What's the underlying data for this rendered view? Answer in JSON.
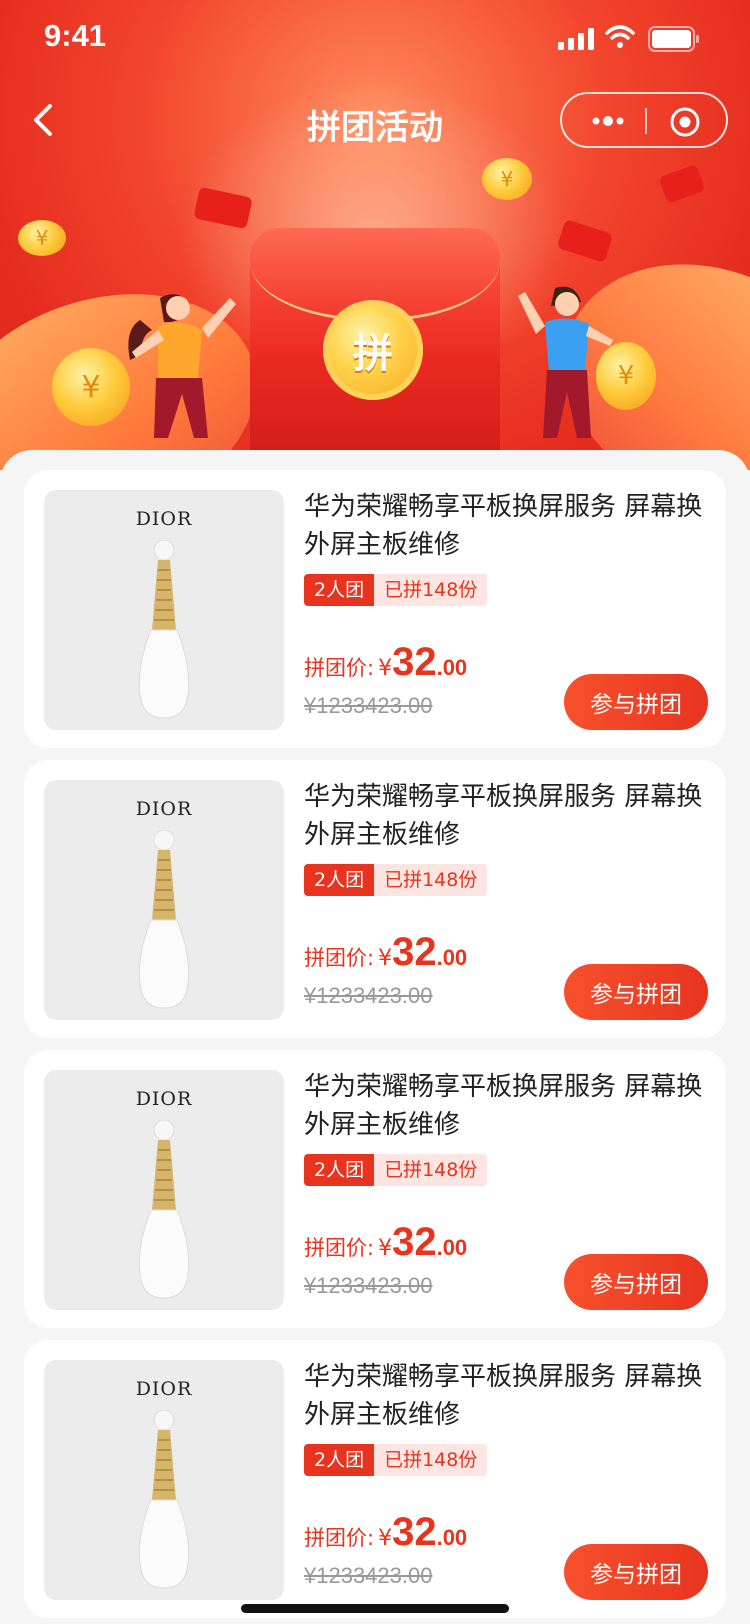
{
  "status_bar": {
    "time": "9:41"
  },
  "nav": {
    "title": "拼团活动",
    "back_icon": "chevron-left-icon",
    "more_icon": "more-dots-icon",
    "close_icon": "target-circle-icon"
  },
  "banner": {
    "badge_text": "拼",
    "coin_symbol": "¥"
  },
  "products": [
    {
      "brand": "DIOR",
      "name": "华为荣耀畅享平板换屏服务 屏幕换外屏主板维修",
      "group_tag": "2人团",
      "joined_tag": "已拼148份",
      "price_label": "拼团价:",
      "currency": "¥",
      "price_int": "32",
      "price_dec": ".00",
      "original_price": "¥1233423.00",
      "button": "参与拼团"
    },
    {
      "brand": "DIOR",
      "name": "华为荣耀畅享平板换屏服务 屏幕换外屏主板维修",
      "group_tag": "2人团",
      "joined_tag": "已拼148份",
      "price_label": "拼团价:",
      "currency": "¥",
      "price_int": "32",
      "price_dec": ".00",
      "original_price": "¥1233423.00",
      "button": "参与拼团"
    },
    {
      "brand": "DIOR",
      "name": "华为荣耀畅享平板换屏服务 屏幕换外屏主板维修",
      "group_tag": "2人团",
      "joined_tag": "已拼148份",
      "price_label": "拼团价:",
      "currency": "¥",
      "price_int": "32",
      "price_dec": ".00",
      "original_price": "¥1233423.00",
      "button": "参与拼团"
    },
    {
      "brand": "DIOR",
      "name": "华为荣耀畅享平板换屏服务 屏幕换外屏主板维修",
      "group_tag": "2人团",
      "joined_tag": "已拼148份",
      "price_label": "拼团价:",
      "currency": "¥",
      "price_int": "32",
      "price_dec": ".00",
      "original_price": "¥1233423.00",
      "button": "参与拼团"
    }
  ],
  "colors": {
    "accent": "#e8341f",
    "hero_red": "#f2442c",
    "tag_bg": "#fde5e2",
    "strike_gray": "#999999"
  }
}
